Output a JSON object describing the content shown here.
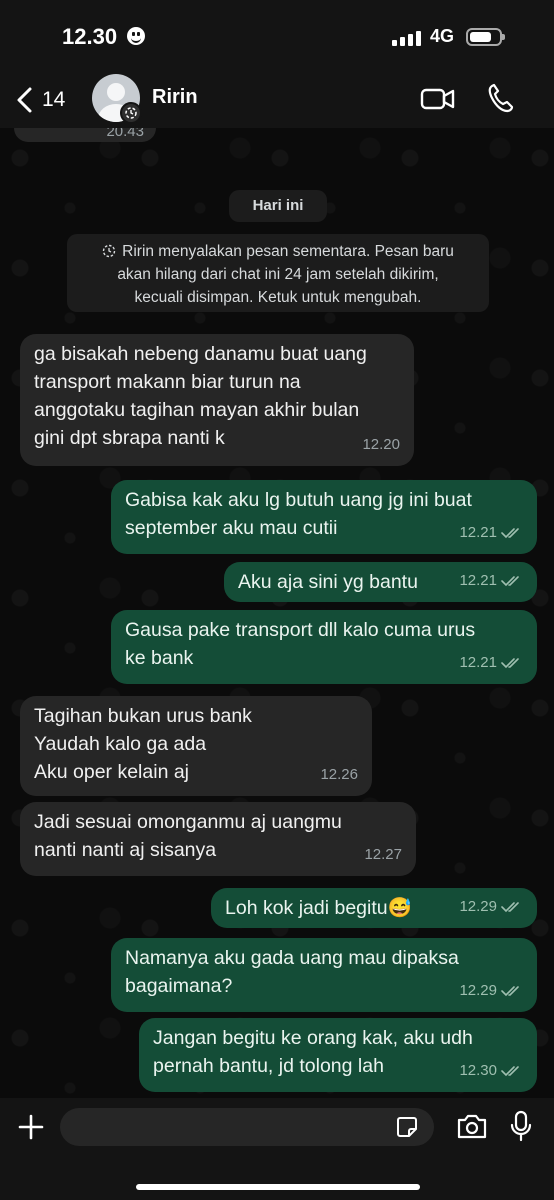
{
  "status_bar": {
    "time": "12.30",
    "network": "4G",
    "battery_level": 0.75
  },
  "header": {
    "back_count": "14",
    "contact_name": "Ririn"
  },
  "chat": {
    "previous_message_time": "20.43",
    "day_separator": "Hari ini",
    "system_notice": [
      "Ririn menyalakan pesan sementara. Pesan baru",
      "akan hilang dari chat ini 24 jam setelah dikirim,",
      "kecuali disimpan. Ketuk untuk mengubah."
    ],
    "messages": [
      {
        "direction": "incoming",
        "lines": [
          "ga bisakah nebeng danamu buat uang",
          "transport makann biar turun na",
          "anggotaku tagihan mayan akhir bulan",
          "gini dpt sbrapa nanti k"
        ],
        "time": "12.20"
      },
      {
        "direction": "outgoing",
        "lines": [
          "Gabisa kak aku lg butuh uang jg ini buat",
          "september aku mau cutii"
        ],
        "time": "12.21"
      },
      {
        "direction": "outgoing",
        "lines": [
          "Aku aja sini yg bantu"
        ],
        "time": "12.21"
      },
      {
        "direction": "outgoing",
        "lines": [
          "Gausa pake transport dll kalo cuma urus",
          "ke bank"
        ],
        "time": "12.21"
      },
      {
        "direction": "incoming",
        "lines": [
          "Tagihan bukan urus bank",
          "Yaudah kalo ga ada",
          "Aku oper kelain aj"
        ],
        "time": "12.26"
      },
      {
        "direction": "incoming",
        "lines": [
          "Jadi sesuai omonganmu aj uangmu",
          "nanti nanti aj sisanya"
        ],
        "time": "12.27"
      },
      {
        "direction": "outgoing",
        "lines": [
          "Loh kok jadi begitu😅"
        ],
        "time": "12.29"
      },
      {
        "direction": "outgoing",
        "lines": [
          "Namanya aku gada uang mau dipaksa",
          "bagaimana?"
        ],
        "time": "12.29"
      },
      {
        "direction": "outgoing",
        "lines": [
          "Jangan begitu ke orang kak, aku udh",
          "pernah bantu, jd tolong lah"
        ],
        "time": "12.30"
      }
    ]
  },
  "input_bar": {
    "placeholder": ""
  },
  "colors": {
    "incoming_bubble": "#262626",
    "outgoing_bubble": "#144d37",
    "background": "#0b0b0b"
  }
}
